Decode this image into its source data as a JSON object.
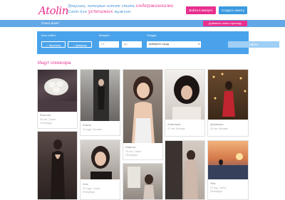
{
  "header": {
    "logo": "Atolin",
    "slogan_part1": "Девушки, которые хотят стать",
    "slogan_hl1": "содержанками",
    "slogan_part2": "Сайт для",
    "slogan_hl2": "успешных",
    "slogan_part3": "мужчин",
    "login_label": "Войти в аккаунт",
    "create_label": "Создать анкету"
  },
  "nav": {
    "search_label": "Поиск анкет",
    "mypage_label": "Добавить свою страницу"
  },
  "filter": {
    "who_label": "Кого найти",
    "man_label": "Мужчину",
    "girl_label": "Девушку",
    "age_label": "Возраст",
    "age_from": "От",
    "age_to": "До",
    "city_label": "Откуда",
    "city_value": "выберите город",
    "find_label": "Найти"
  },
  "section_title": "Ищут спонсора",
  "cards": [
    {
      "name": "Евгения",
      "info1": "28 лет, Санкт-",
      "info2": "Петербург"
    },
    {
      "name": "Алина",
      "info1": "24 года, Москва",
      "info2": ""
    },
    {
      "name": "Камила",
      "info1": "19 лет, Санкт-",
      "info2": "Петербург"
    },
    {
      "name": "Анжелика",
      "info1": "27 лет, Москва",
      "info2": ""
    },
    {
      "name": "Доминика",
      "info1": "29 лет, Москва",
      "info2": ""
    },
    {
      "name": "Оля",
      "info1": "22 года, Санкт-",
      "info2": "Петербург"
    },
    {
      "name": "Яна",
      "info1": "21 год, Санкт-",
      "info2": "Петербург"
    }
  ]
}
